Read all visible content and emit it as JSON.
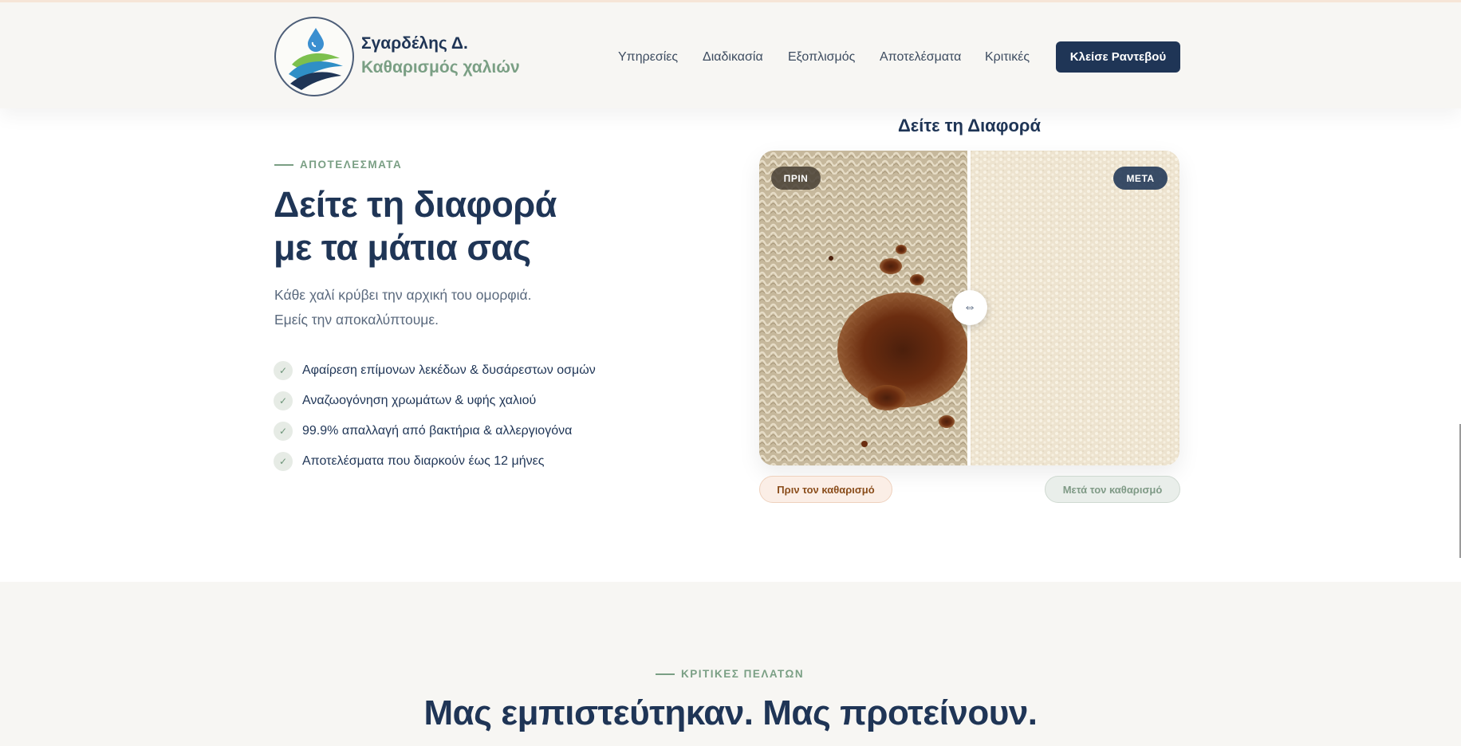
{
  "brand": {
    "name": "Σγαρδέλης Δ.",
    "tagline": "Καθαρισμός χαλιών"
  },
  "nav": {
    "items": [
      "Υπηρεσίες",
      "Διαδικασία",
      "Εξοπλισμός",
      "Αποτελέσματα",
      "Κριτικές"
    ],
    "cta": "Κλείσε Ραντεβού"
  },
  "results": {
    "eyebrow": "ΑΠΟΤΕΛΕΣΜΑΤΑ",
    "title_line1": "Δείτε τη διαφορά",
    "title_line2": "με τα μάτια σας",
    "lead_line1": "Κάθε χαλί κρύβει την αρχική του ομορφιά.",
    "lead_line2": "Εμείς την αποκαλύπτουμε.",
    "check_glyph": "✓",
    "features": [
      "Αφαίρεση επίμονων λεκέδων & δυσάρεστων οσμών",
      "Αναζωογόνηση χρωμάτων & υφής χαλιού",
      "99.9% απαλλαγή από βακτήρια & αλλεργιογόνα",
      "Αποτελέσματα που διαρκούν έως 12 μήνες"
    ]
  },
  "compare": {
    "title": "Δείτε τη Διαφορά",
    "before_tag": "ΠΡΙΝ",
    "after_tag": "ΜΕΤΑ",
    "handle_glyph": "⇔",
    "before_caption": "Πριν τον καθαρισμό",
    "after_caption": "Μετά τον καθαρισμό",
    "slider_position": 0.5
  },
  "reviews": {
    "eyebrow": "ΚΡΙΤΙΚΕΣ ΠΕΛΑΤΩΝ",
    "title": "Μας εμπιστεύτηκαν. Μας προτείνουν."
  },
  "colors": {
    "navy": "#1f3556",
    "sage": "#7a9f84",
    "rust": "#8a4d1b",
    "page_bg": "#f7f6f3"
  }
}
